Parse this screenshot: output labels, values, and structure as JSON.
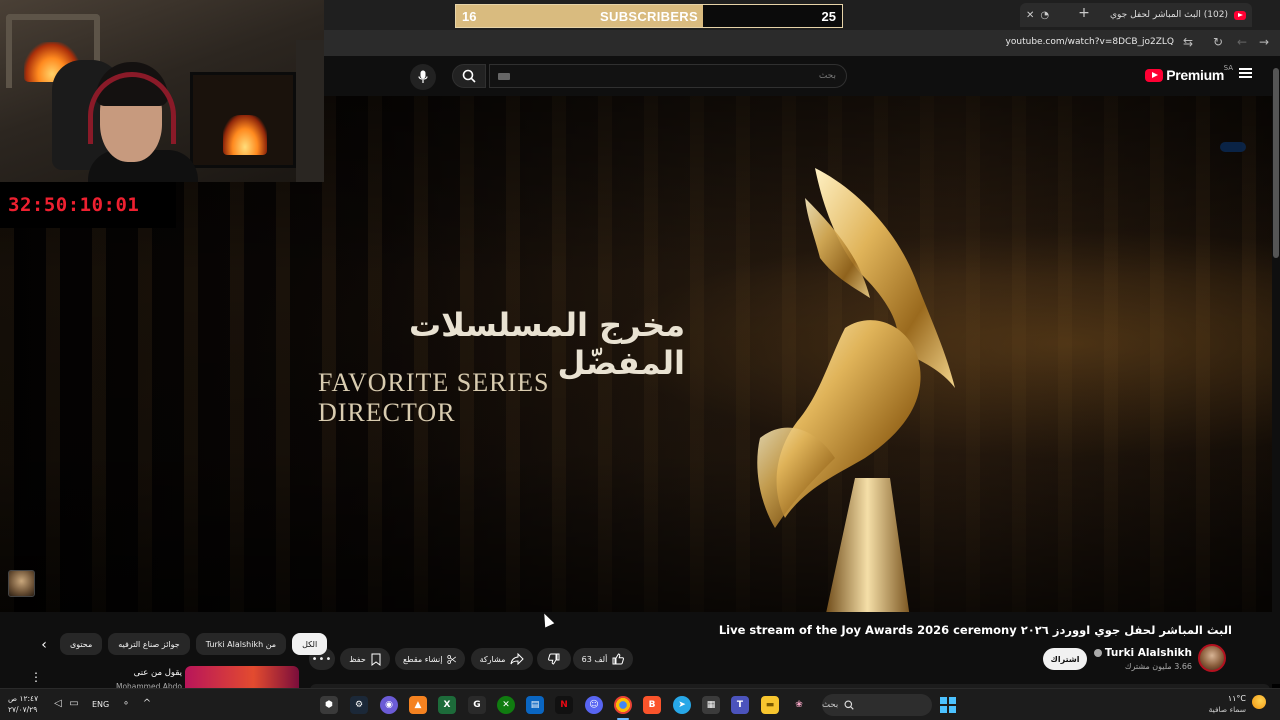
{
  "browser": {
    "tab_title": "(102) البث المباشر لحفل جوي",
    "url": "youtube.com/watch?v=8DCB_jo2ZLQ",
    "new_tab_label": "+"
  },
  "youtube": {
    "logo_text": "Premium",
    "logo_country": "SA",
    "search_placeholder": "بحث"
  },
  "overlay": {
    "timer": "32:50:10:01",
    "subscriber_goal": {
      "current": "16",
      "label": "SUBSCRIBERS",
      "target": "25",
      "progress": 0.64
    }
  },
  "video": {
    "arabic_caption": "مخرج المسلسلات المفضّل",
    "english_caption": "FAVORITE SERIES DIRECTOR"
  },
  "watch": {
    "title": "Live stream of the Joy Awards 2026 ceremony البث المباشر لحفل جوي اووردز ٢٠٢٦",
    "channel_name": "Turki Alalshikh",
    "channel_subs": "3.66 مليون مشترك",
    "subscribe_label": "اشتراك",
    "like_count": "63 ألف",
    "share_label": "مشاركة",
    "clip_label": "إنشاء مقطع",
    "save_label": "حفظ"
  },
  "chips": [
    {
      "label": "الكل",
      "active": true
    },
    {
      "label": "من Turki Alalshikh",
      "active": false
    },
    {
      "label": "جوائز صناع الترفيه",
      "active": false
    },
    {
      "label": "محتوى",
      "active": false
    }
  ],
  "recommendation": {
    "title": "يقول من عنى",
    "channel": "Mohammed Abdo"
  },
  "taskbar": {
    "time": "١٢:٤٧ ص",
    "date": "٢٧/٠٧/٢٩",
    "language": "ENG",
    "search_placeholder": "بحث",
    "weather_temp": "١١°C",
    "weather_desc": "سماء صافية"
  },
  "colors": {
    "youtube_red": "#ff0033",
    "timer_red": "#ee2030",
    "goal_fill": "#d9bb7f",
    "windows_blue": "#4cc2ff"
  }
}
